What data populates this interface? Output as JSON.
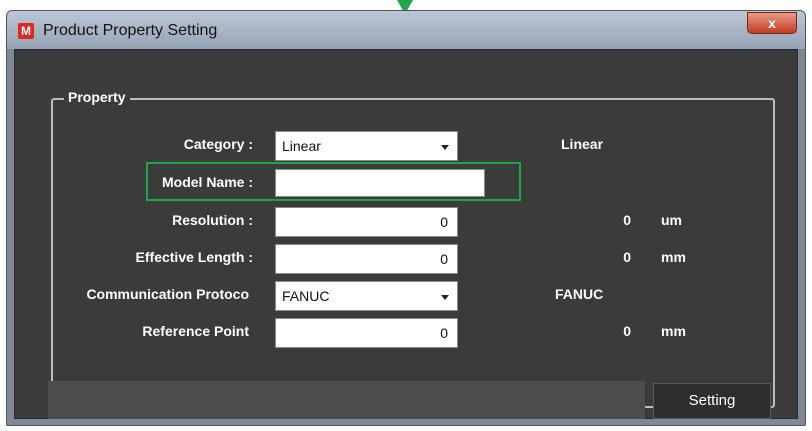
{
  "window": {
    "title": "Product Property Setting",
    "app_icon_letter": "M",
    "close_glyph": "x"
  },
  "property_group": {
    "legend": "Property",
    "rows": [
      {
        "label": "Category :",
        "control": "select",
        "value": "Linear",
        "readout": "Linear",
        "unit": ""
      },
      {
        "label": "Model Name :",
        "control": "text",
        "value": "",
        "readout": "",
        "unit": ""
      },
      {
        "label": "Resolution :",
        "control": "number",
        "value": "0",
        "readout": "0",
        "unit": "um"
      },
      {
        "label": "Effective Length :",
        "control": "number",
        "value": "0",
        "readout": "0",
        "unit": "mm"
      },
      {
        "label": "Communication Protoco",
        "control": "select",
        "value": "FANUC",
        "readout": "FANUC",
        "unit": ""
      },
      {
        "label": "Reference Point",
        "control": "number",
        "value": "0",
        "readout": "0",
        "unit": "mm"
      }
    ]
  },
  "footer": {
    "status_text": "",
    "setting_button": "Setting"
  },
  "colors": {
    "highlight": "#19a845",
    "panel_bg": "#3b3b3b",
    "close_button": "#c43b22"
  },
  "icons": {
    "app": "m-app-icon",
    "close": "close-icon",
    "dropdown": "chevron-down-icon",
    "callout": "down-arrow-callout-icon"
  }
}
